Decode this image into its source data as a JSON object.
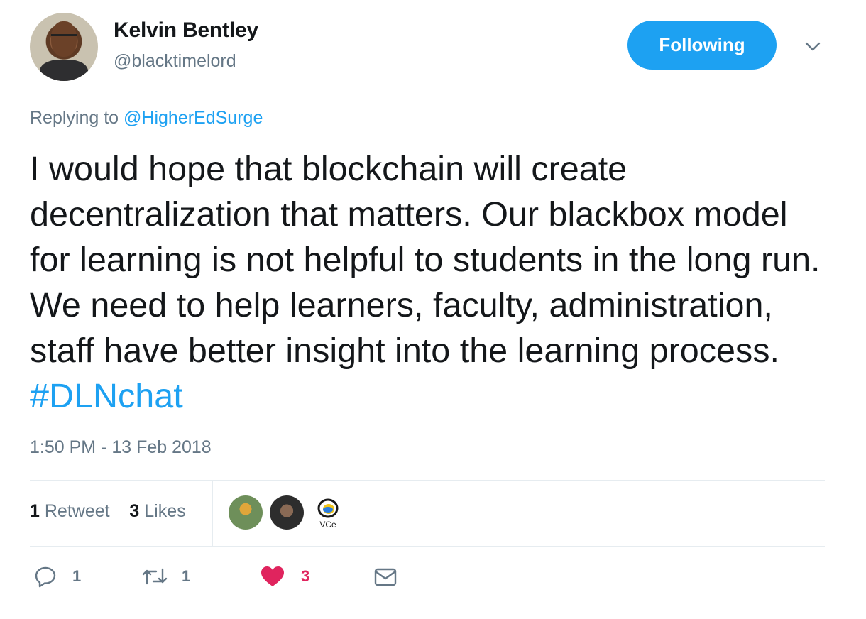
{
  "author": {
    "name": "Kelvin Bentley",
    "handle": "@blacktimelord"
  },
  "follow_button": "Following",
  "reply": {
    "prefix": "Replying to ",
    "mention": "@HigherEdSurge"
  },
  "tweet": {
    "text": "I would hope that blockchain will create decentralization that matters. Our blackbox model for learning is not helpful to students in the long run. We need to help learners, faculty, administration, staff have better insight into the learning process. ",
    "hashtag": "#DLNchat"
  },
  "timestamp": "1:50 PM - 13 Feb 2018",
  "stats": {
    "retweets_count": "1",
    "retweets_label": "Retweet",
    "likes_count": "3",
    "likes_label": "Likes"
  },
  "liker_badge_text": "VCe",
  "actions": {
    "replies": "1",
    "retweets": "1",
    "likes": "3"
  },
  "colors": {
    "accent": "#1da1f2",
    "secondary_text": "#657786",
    "like": "#e0245e",
    "divider": "#e6ecf0"
  },
  "icons": [
    "caret-down-icon",
    "reply-icon",
    "retweet-icon",
    "heart-icon",
    "mail-icon"
  ]
}
